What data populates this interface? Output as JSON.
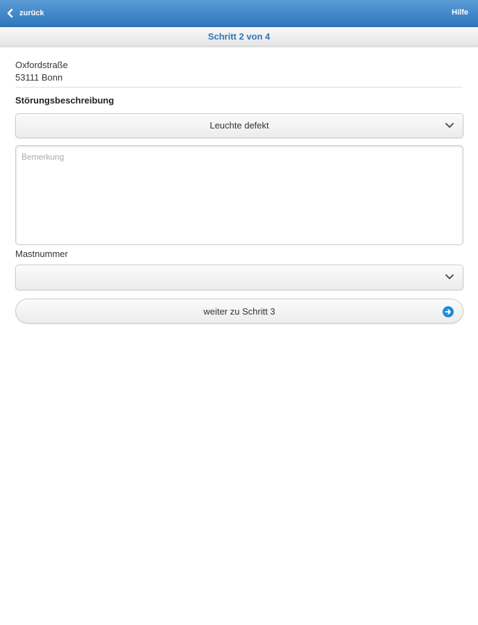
{
  "header": {
    "back_label": "zurück",
    "help_label": "Hilfe",
    "step_label": "Schritt 2 von 4"
  },
  "address": {
    "street": "Oxfordstraße",
    "city": "53111 Bonn"
  },
  "form": {
    "section_title": "Störungsbeschreibung",
    "fault_select": {
      "value": "Leuchte defekt"
    },
    "remark": {
      "placeholder": "Bemerkung",
      "value": ""
    },
    "mast_label": "Mastnummer",
    "mast_select": {
      "value": ""
    },
    "next_button_label": "weiter zu Schritt 3"
  },
  "colors": {
    "header_bar": "#2f77bd",
    "accent_text": "#2f77bd",
    "arrow_icon": "#1e8ad6"
  },
  "icons": {
    "back": "chevron-left-icon",
    "select": "chevron-down-icon",
    "next": "arrow-right-circle-icon"
  }
}
